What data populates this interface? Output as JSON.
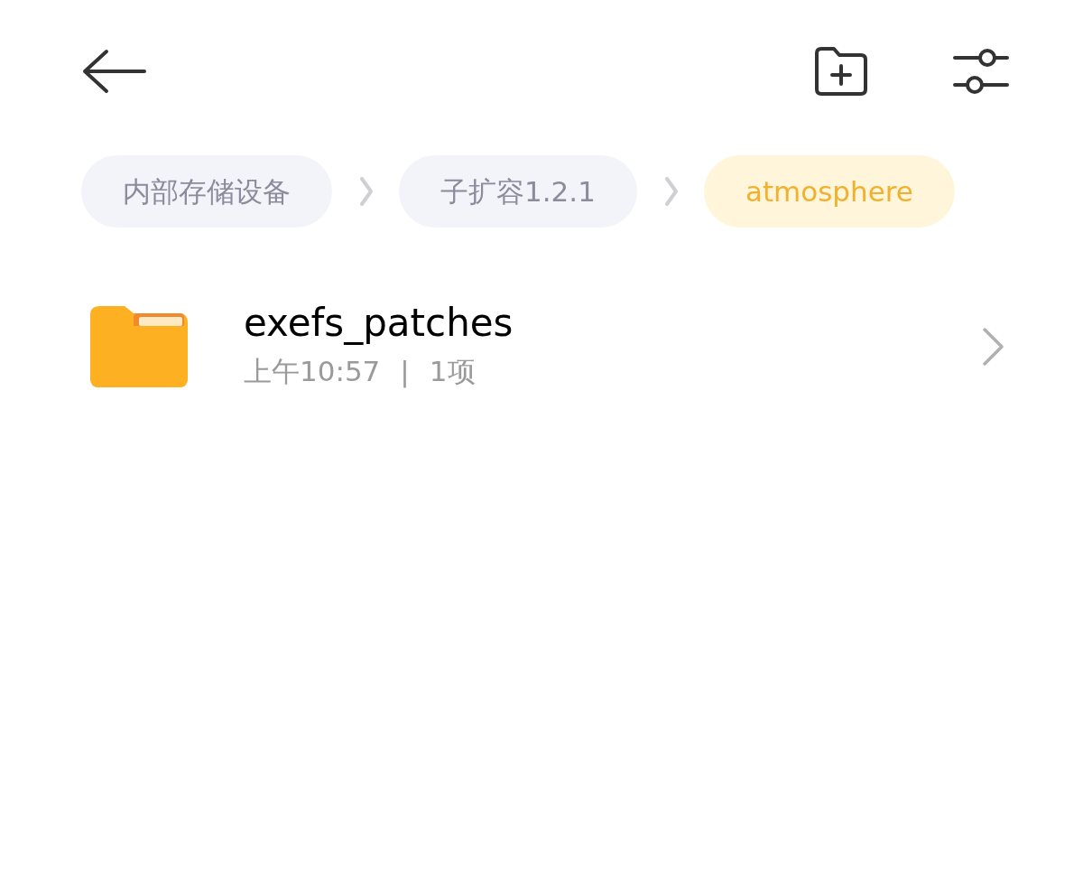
{
  "breadcrumbs": [
    {
      "label": "内部存储设备",
      "selected": false
    },
    {
      "label": "子扩容1.2.1",
      "selected": false
    },
    {
      "label": "atmosphere",
      "selected": true
    }
  ],
  "files": [
    {
      "name": "exefs_patches",
      "time": "上午10:57",
      "separator": "|",
      "count": "1项"
    }
  ]
}
